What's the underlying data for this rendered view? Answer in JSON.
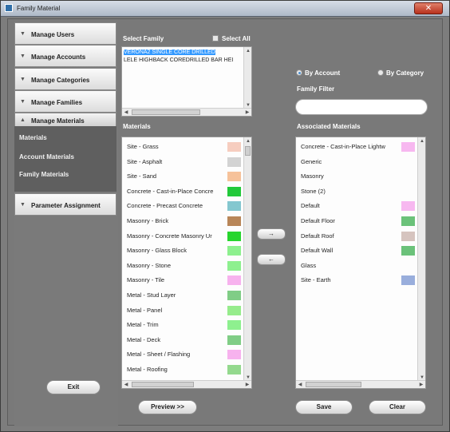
{
  "window": {
    "title": "Family Material",
    "close_label": "✕"
  },
  "sidebar": {
    "items": [
      {
        "label": "Manage Users"
      },
      {
        "label": "Manage Accounts"
      },
      {
        "label": "Manage Categories"
      },
      {
        "label": "Manage Families"
      },
      {
        "label": "Manage Materials"
      },
      {
        "label": "Parameter Assignment"
      }
    ],
    "sub_items": [
      {
        "label": "Materials"
      },
      {
        "label": "Account Materials"
      },
      {
        "label": "Family Materials"
      }
    ],
    "exit_label": "Exit"
  },
  "select_family": {
    "label": "Select Family",
    "select_all_label": "Select All",
    "items": [
      {
        "label": "VERONA2 SINGLE CORE DRILLED",
        "selected": true
      },
      {
        "label": "LELE HIGHBACK COREDRILLED BAR HEI",
        "selected": false
      }
    ]
  },
  "filter": {
    "by_account_label": "By Account",
    "by_category_label": "By Category",
    "family_filter_label": "Family Filter",
    "family_filter_value": ""
  },
  "materials": {
    "label": "Materials",
    "items": [
      {
        "name": "Site - Grass",
        "color": "#f6cdbf"
      },
      {
        "name": "Site - Asphalt",
        "color": "#d3d3d3"
      },
      {
        "name": "Site - Sand",
        "color": "#f6c29a"
      },
      {
        "name": "Concrete - Cast-in-Place Concre",
        "color": "#22c93a"
      },
      {
        "name": "Concrete - Precast Concrete",
        "color": "#84c7cf"
      },
      {
        "name": "Masonry - Brick",
        "color": "#b88658"
      },
      {
        "name": "Masonry - Concrete Masonry Ur",
        "color": "#27d52d"
      },
      {
        "name": "Masonry - Glass Block",
        "color": "#8df08e"
      },
      {
        "name": "Masonry - Stone",
        "color": "#8ef08f"
      },
      {
        "name": "Masonry - Tile",
        "color": "#f7b2ee"
      },
      {
        "name": "Metal - Stud Layer",
        "color": "#80cd86"
      },
      {
        "name": "Metal - Panel",
        "color": "#96ec8c"
      },
      {
        "name": "Metal - Trim",
        "color": "#8ef08f"
      },
      {
        "name": "Metal - Deck",
        "color": "#80cd86"
      },
      {
        "name": "Metal - Sheet / Flashing",
        "color": "#f7b2ee"
      },
      {
        "name": "Metal - Roofing",
        "color": "#94d98e"
      }
    ]
  },
  "associated": {
    "label": "Associated Materials",
    "items": [
      {
        "name": "Concrete - Cast-in-Place Lightw",
        "color": "#f7b8f0"
      },
      {
        "name": "Generic",
        "color": ""
      },
      {
        "name": "Masonry",
        "color": ""
      },
      {
        "name": "Stone (2)",
        "color": ""
      },
      {
        "name": "Default",
        "color": "#f7b8f0"
      },
      {
        "name": "Default Floor",
        "color": "#6bc27a"
      },
      {
        "name": "Default Roof",
        "color": "#d6c4bf"
      },
      {
        "name": "Default Wall",
        "color": "#6bc27a"
      },
      {
        "name": "Glass",
        "color": ""
      },
      {
        "name": "Site - Earth",
        "color": "#99aedc"
      }
    ]
  },
  "buttons": {
    "add_label": "→",
    "remove_label": "←",
    "preview_label": "Preview >>",
    "save_label": "Save",
    "clear_label": "Clear"
  }
}
